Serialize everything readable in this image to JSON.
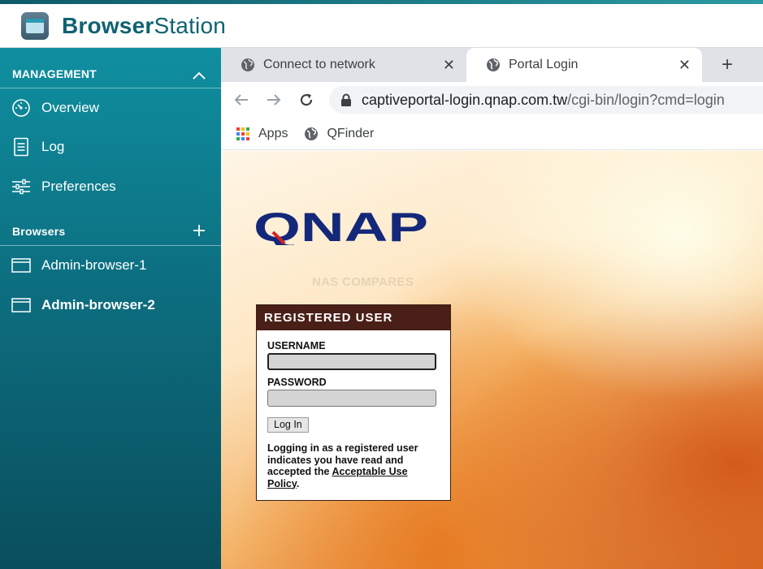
{
  "app": {
    "title_bold": "Browser",
    "title_light": "Station"
  },
  "sidebar": {
    "management": {
      "label": "MANAGEMENT",
      "toggle_icon": "chevron-up-icon",
      "items": [
        {
          "label": "Overview",
          "icon": "gauge-icon"
        },
        {
          "label": "Log",
          "icon": "document-icon"
        },
        {
          "label": "Preferences",
          "icon": "sliders-icon"
        }
      ]
    },
    "browsers": {
      "label": "Browsers",
      "add_icon": "plus-icon",
      "items": [
        {
          "label": "Admin-browser-1",
          "icon": "browser-window-icon",
          "active": false
        },
        {
          "label": "Admin-browser-2",
          "icon": "browser-window-icon",
          "active": true
        }
      ]
    }
  },
  "browser": {
    "tabs": [
      {
        "label": "Connect to network",
        "active": false
      },
      {
        "label": "Portal Login",
        "active": true
      }
    ],
    "new_tab_symbol": "+",
    "close_symbol": "✕",
    "url_host": "captiveportal-login.qnap.com.tw",
    "url_path": "/cgi-bin/login?cmd=login",
    "bookmarks": [
      {
        "label": "Apps",
        "icon": "apps-grid-icon"
      },
      {
        "label": "QFinder",
        "icon": "globe-icon"
      }
    ]
  },
  "page": {
    "logo_text": "QNAP",
    "watermark": "NAS COMPARES",
    "login": {
      "header": "REGISTERED USER",
      "username_label": "USERNAME",
      "password_label": "PASSWORD",
      "username_value": "",
      "password_value": "",
      "button_label": "Log In",
      "notice_prefix": "Logging in as a registered user indicates you have read and accepted the ",
      "notice_link": "Acceptable Use Policy",
      "notice_suffix": "."
    }
  },
  "colors": {
    "accent": "#0f6272",
    "sidebar_top": "#0f8fa0",
    "sidebar_bottom": "#0a4e5d",
    "login_header": "#4a1f17",
    "qnap_blue": "#14287a"
  }
}
